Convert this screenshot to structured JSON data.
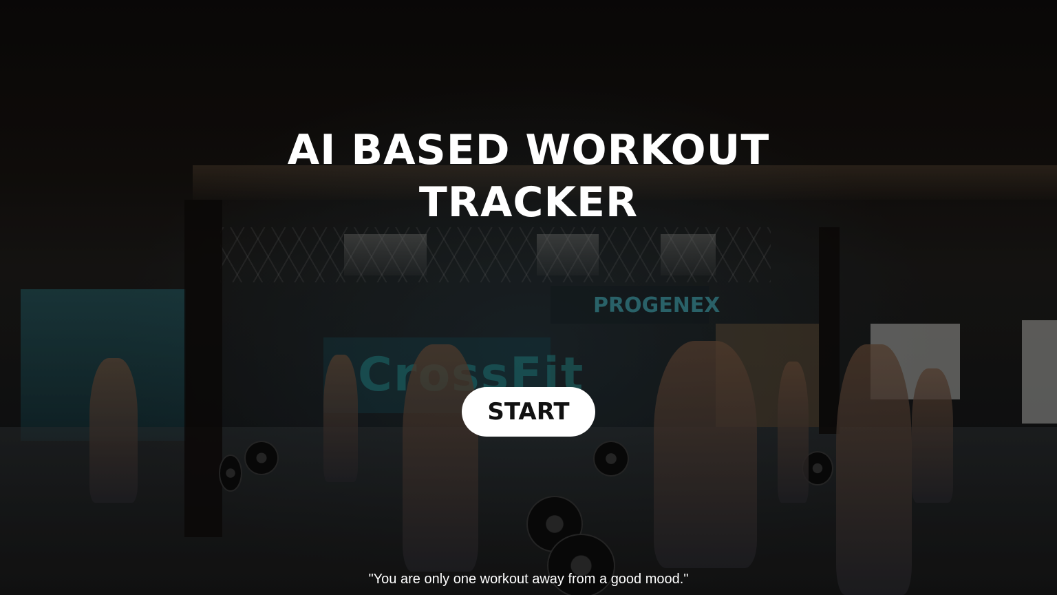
{
  "hero": {
    "title_line1": "AI BASED WORKOUT",
    "title_line2": "TRACKER",
    "start_label": "START",
    "quote": "\"You are only one workout away from a good mood.\""
  },
  "background": {
    "description_icon": "gym-background-image",
    "wall_texts": [
      "CrossFit",
      "PROGENEX"
    ]
  },
  "colors": {
    "text": "#ffffff",
    "button_bg": "#ffffff",
    "button_text": "#111111",
    "overlay": "#000000"
  }
}
